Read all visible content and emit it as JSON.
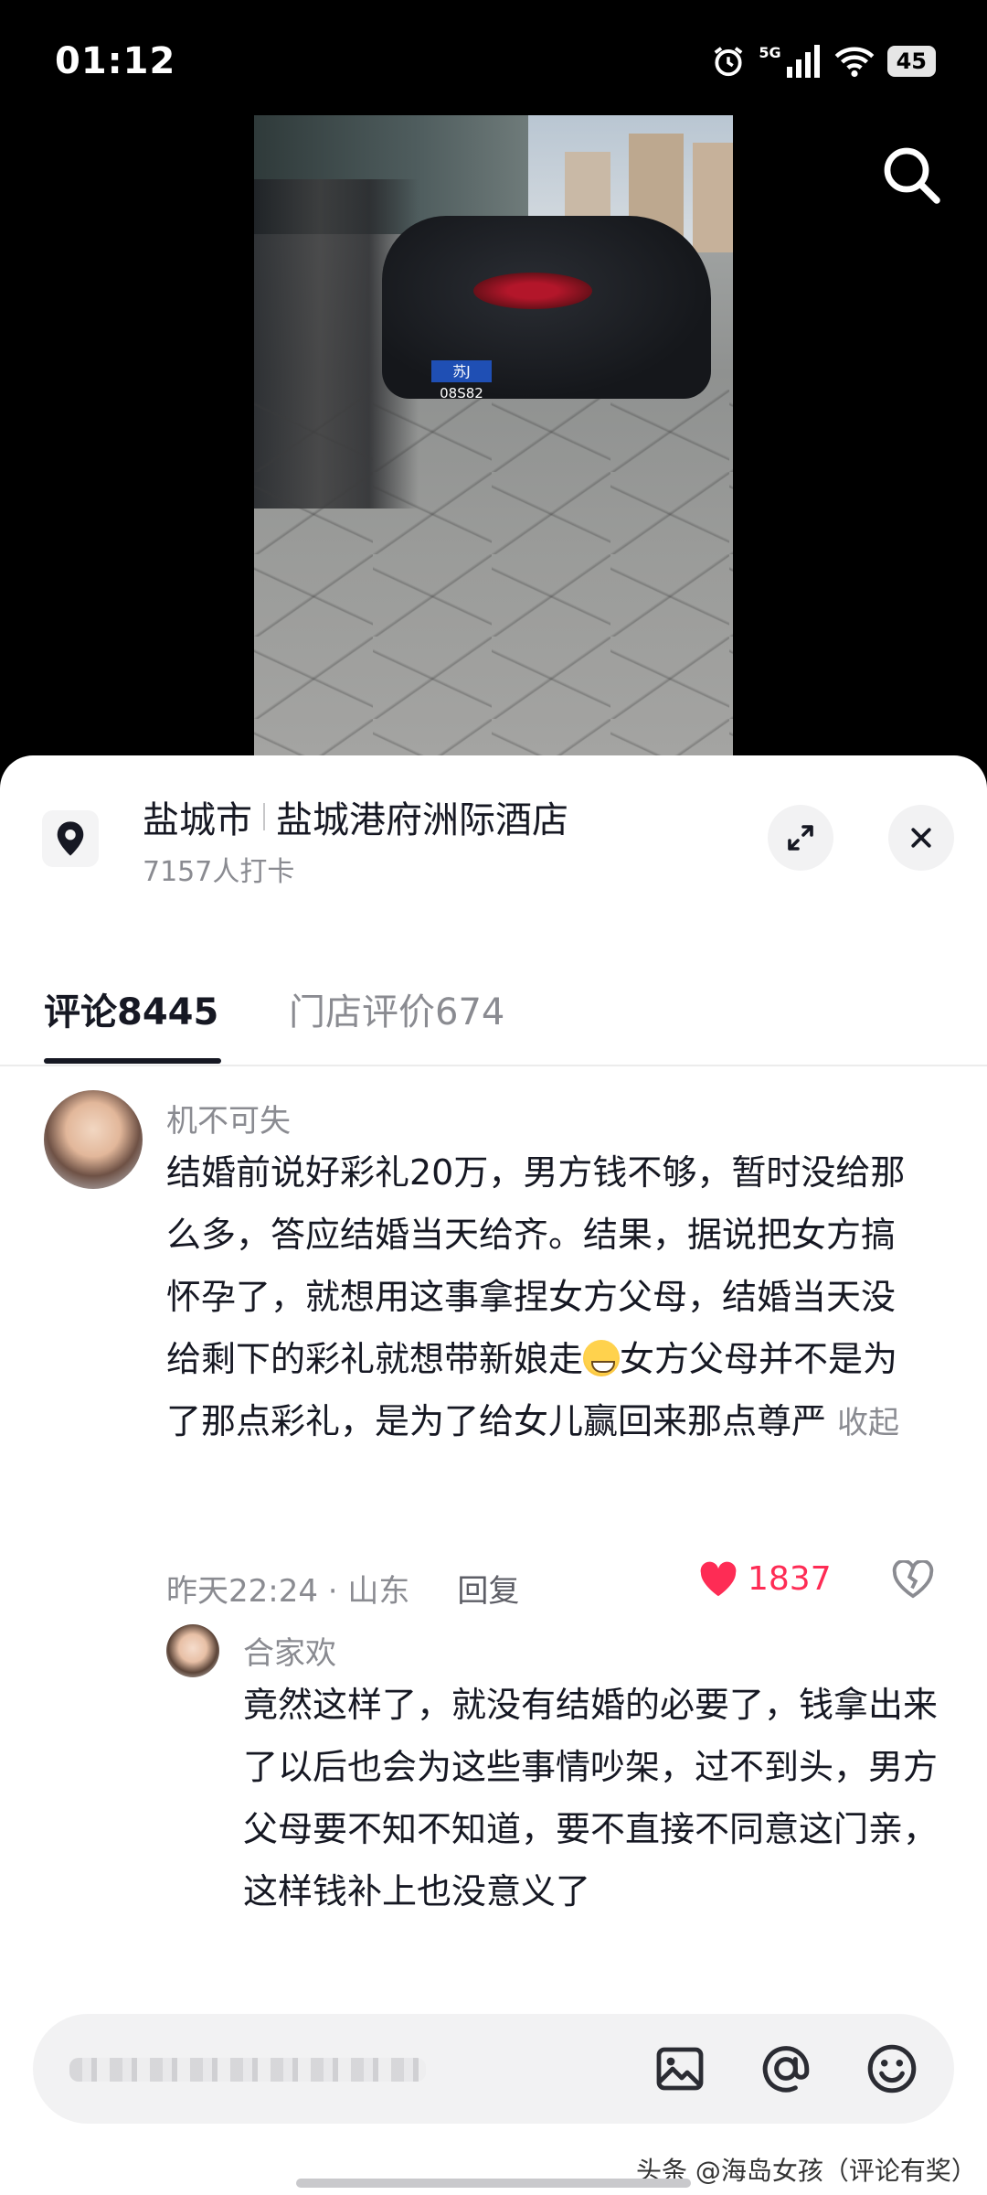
{
  "status_bar": {
    "time": "01:12",
    "network": "5G",
    "battery": "45"
  },
  "video": {
    "plate": "苏J 08S82"
  },
  "location": {
    "city": "盐城市",
    "place": "盐城港府洲际酒店",
    "checkins": "7157人打卡"
  },
  "tabs": [
    {
      "label": "评论",
      "count": "8445",
      "active": true
    },
    {
      "label": "门店评价",
      "count": "674",
      "active": false
    }
  ],
  "comments": [
    {
      "author": "机不可失",
      "text_part1": "结婚前说好彩礼20万，男方钱不够，暂时没给那么多，答应结婚当天给齐。结果，据说把女方搞怀孕了，就想用这事拿捏女方父母，结婚当天没给剩下的彩礼就想带新娘走",
      "text_part2": "女方父母并不是为了那点彩礼，是为了给女儿赢回来那点尊严",
      "collapse": "收起",
      "time": "昨天22:24 · 山东",
      "reply_label": "回复",
      "likes": "1837"
    }
  ],
  "reply": {
    "author": "合家欢",
    "text": "竟然这样了，就没有结婚的必要了，钱拿出来了以后也会为这些事情吵架，过不到头，男方父母要不知不知道，要不直接不同意这门亲，这样钱补上也没意义了"
  },
  "watermark": "头条 @海岛女孩（评论有奖）",
  "colors": {
    "like": "#fe2c55",
    "text": "#161823",
    "muted": "#8a8b91"
  }
}
